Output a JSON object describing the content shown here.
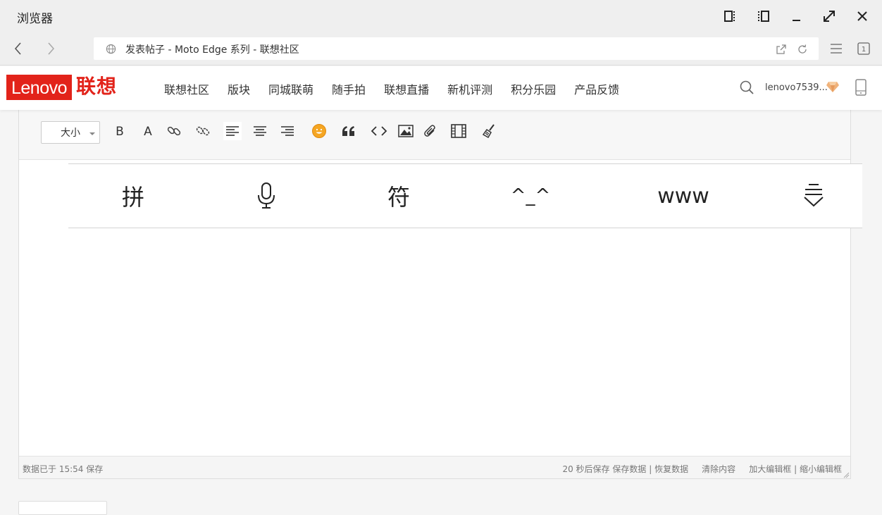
{
  "window": {
    "title": "浏览器"
  },
  "browser": {
    "address_text": "发表帖子 - Moto Edge 系列 - 联想社区",
    "tab_count": "1"
  },
  "site": {
    "logo_en": "Lenovo",
    "logo_cn": "联想",
    "nav": [
      "联想社区",
      "版块",
      "同城联萌",
      "随手拍",
      "联想直播",
      "新机评测",
      "积分乐园",
      "产品反馈"
    ],
    "username": "lenovo7539..."
  },
  "editor": {
    "size_label": "大小",
    "toolbar_icons": [
      "bold-icon",
      "font-color-icon",
      "link-icon",
      "unlink-icon",
      "align-left-icon",
      "align-center-icon",
      "align-right-icon",
      "emoji-icon",
      "quote-icon",
      "code-icon",
      "image-icon",
      "attachment-icon",
      "video-icon",
      "clear-format-icon"
    ],
    "status": {
      "saved": "数据已于 15:54 保存",
      "autosave": "20 秒后保存",
      "save_data": "保存数据",
      "restore_data": "恢复数据",
      "clear_content": "清除内容",
      "enlarge": "加大编辑框",
      "shrink": "缩小编辑框",
      "separator": "|"
    }
  },
  "keyboard": {
    "keys": [
      "拼",
      "mic-icon",
      "符",
      "^_^",
      "www",
      "hide-keyboard-icon"
    ],
    "pinyin": "拼",
    "symbols": "符",
    "emoticon": "^_^",
    "web": "www"
  },
  "colors": {
    "brand": "#e2231a",
    "emoji": "#f5a623"
  }
}
